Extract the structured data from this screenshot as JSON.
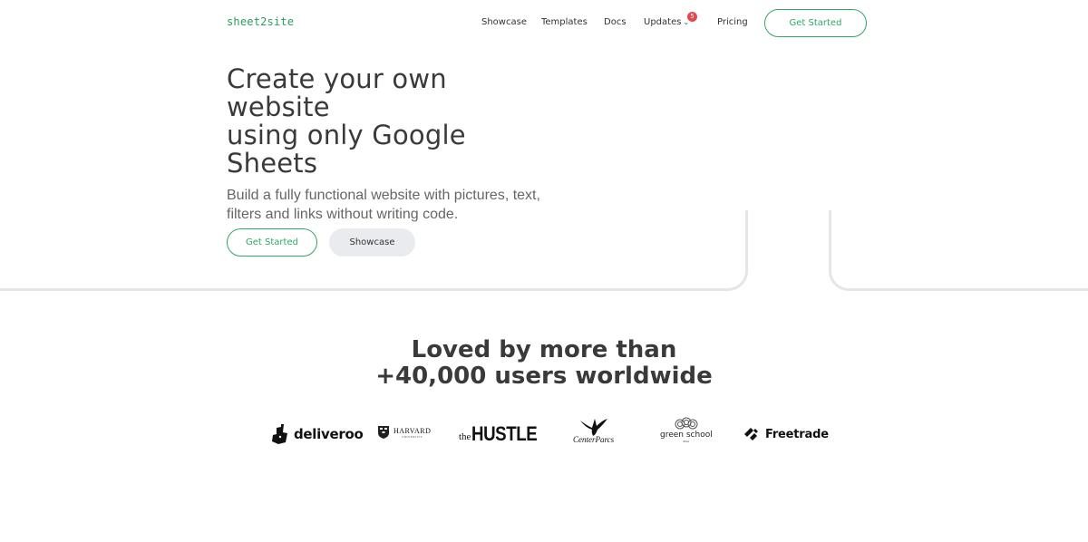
{
  "nav": {
    "logo": "sheet2site",
    "links": [
      "Showcase",
      "Templates",
      "Docs",
      "Updates",
      "Pricing"
    ],
    "updates_badge": "5",
    "cta": "Get Started"
  },
  "hero": {
    "title_lines": [
      "Create your own",
      "website",
      "using only Google",
      "Sheets"
    ],
    "subtitle": "Build a fully functional website with pictures, text, filters and links without writing code.",
    "primary_button": "Get Started",
    "secondary_button": "Showcase"
  },
  "loved": {
    "title_lines": [
      "Loved by more than",
      "+40,000 users worldwide"
    ]
  },
  "logos": {
    "deliveroo": "deliveroo",
    "harvard_main": "HARVARD",
    "harvard_sub": "UNIVERSITY",
    "hustle_prefix": "the",
    "hustle_main": "HUSTLE",
    "centerparcs": "CenterParcs",
    "greenschool": "green school",
    "greenschool_sub": "BALI",
    "freetrade": "Freetrade"
  },
  "colors": {
    "accent": "#2fa866",
    "logo_green": "#2a9d5c",
    "badge": "#e5484d",
    "secondary_bg": "#e9ebee"
  }
}
